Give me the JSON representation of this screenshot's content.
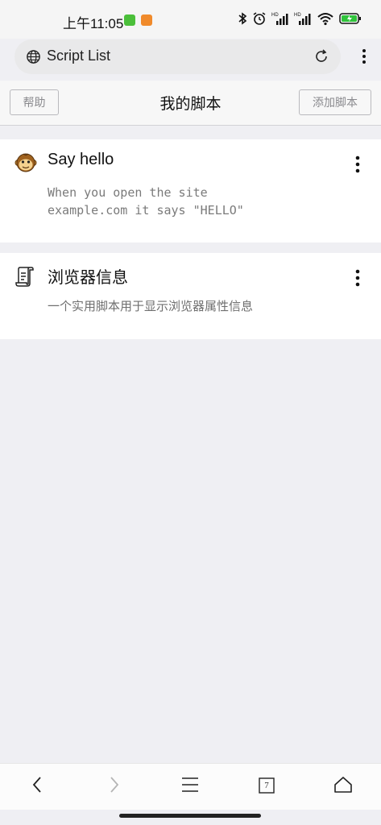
{
  "status_bar": {
    "time": "上午11:05"
  },
  "browser": {
    "url_text": "Script List"
  },
  "header": {
    "help_label": "帮助",
    "title": "我的脚本",
    "add_label": "添加脚本"
  },
  "scripts": [
    {
      "name": "Say hello",
      "description": "When you open the site\nexample.com it says \"HELLO\"",
      "icon": "monkey-icon"
    },
    {
      "name": "浏览器信息",
      "description": "一个实用脚本用于显示浏览器属性信息",
      "icon": "script-scroll-icon"
    }
  ],
  "bottom_nav": {
    "tab_count": "7"
  },
  "colors": {
    "page_background": "#efeff3",
    "card_background": "#ffffff",
    "battery_green": "#2fc33b"
  }
}
